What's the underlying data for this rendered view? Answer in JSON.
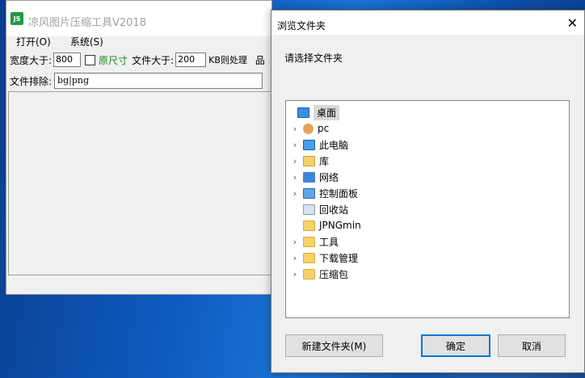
{
  "app": {
    "title": "凉风图片压缩工具V2018",
    "icon_text": "JS",
    "menu": [
      "打开(O)",
      "系统(S)"
    ],
    "width_label": "宽度大于:",
    "width_value": "800",
    "original_size_label": "原尺寸",
    "filesize_label": "文件大于:",
    "filesize_value": "200",
    "filesize_suffix": "KB则处理",
    "cut_label": "品",
    "exclude_label": "文件排除:",
    "exclude_value": "bg|png"
  },
  "dialog": {
    "title": "浏览文件夹",
    "prompt": "请选择文件夹",
    "close_glyph": "✕",
    "tree": [
      {
        "label": "桌面",
        "icon": "desktop-icon",
        "expandable": false,
        "selected": true
      },
      {
        "label": "pc",
        "icon": "user-icon",
        "expandable": true
      },
      {
        "label": "此电脑",
        "icon": "computer-icon",
        "expandable": true
      },
      {
        "label": "库",
        "icon": "library-icon",
        "expandable": true
      },
      {
        "label": "网络",
        "icon": "network-icon",
        "expandable": true
      },
      {
        "label": "控制面板",
        "icon": "control-panel-icon",
        "expandable": true
      },
      {
        "label": "回收站",
        "icon": "recycle-bin-icon",
        "expandable": false
      },
      {
        "label": "JPNGmin",
        "icon": "folder-icon",
        "expandable": false
      },
      {
        "label": "工具",
        "icon": "folder-icon",
        "expandable": true
      },
      {
        "label": "下载管理",
        "icon": "folder-icon",
        "expandable": true
      },
      {
        "label": "压缩包",
        "icon": "folder-icon",
        "expandable": true
      }
    ],
    "new_folder_label": "新建文件夹(M)",
    "ok_label": "确定",
    "cancel_label": "取消"
  }
}
